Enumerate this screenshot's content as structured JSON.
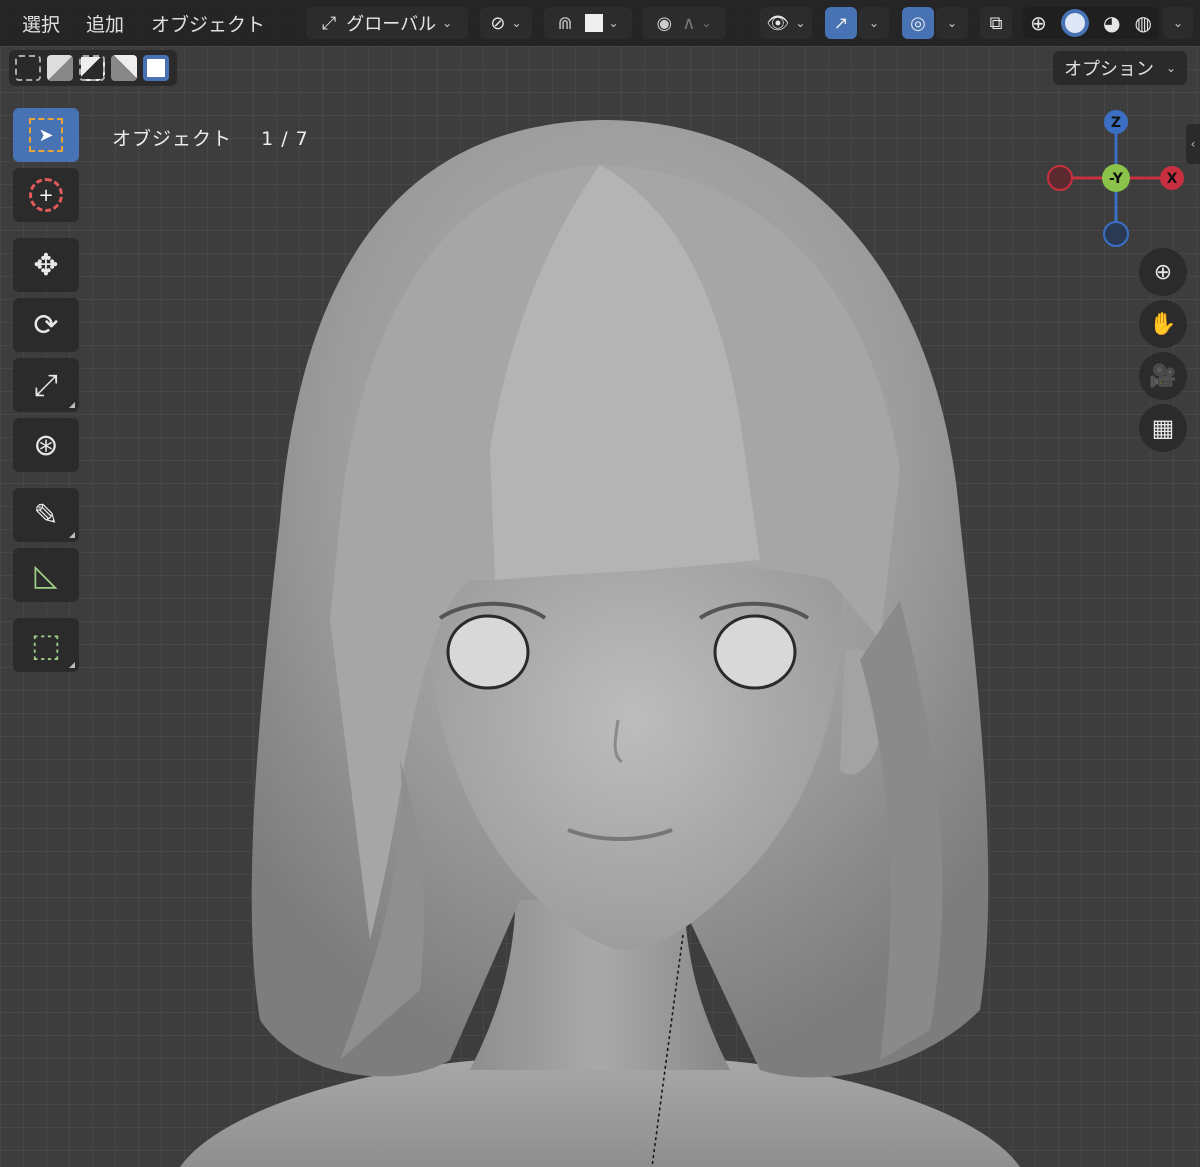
{
  "header": {
    "menus": [
      "選択",
      "追加",
      "オブジェクト"
    ],
    "transform_orientation": "グローバル"
  },
  "toolbar": {
    "options_label": "オプション"
  },
  "viewport": {
    "object_count_label": "オブジェクト",
    "object_count": "1 / 7"
  },
  "gizmo": {
    "z": "Z",
    "neg_y": "-Y",
    "x": "X"
  },
  "icons": {
    "select_box": "select-box-icon",
    "cursor": "cursor-icon",
    "move": "move-icon",
    "rotate": "rotate-icon",
    "scale": "scale-icon",
    "transform": "transform-icon",
    "annotate": "annotate-icon",
    "measure": "measure-icon",
    "add_cube": "add-cube-icon",
    "zoom": "zoom-icon",
    "pan": "hand-icon",
    "camera": "camera-icon",
    "ortho": "grid-icon"
  },
  "colors": {
    "accent": "#4772b3",
    "axis_x": "#c8303f",
    "axis_y": "#8bc34a",
    "axis_z": "#3a6fc4"
  }
}
